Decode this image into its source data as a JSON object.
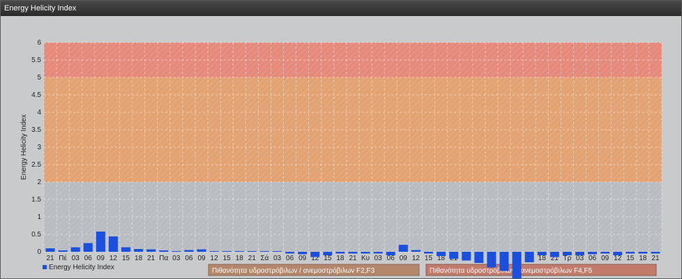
{
  "window": {
    "title": "Energy Helicity Index"
  },
  "colors": {
    "bar": "#1b4fe0",
    "band_low": "#b9bcc0",
    "band_mid": "#e3a272",
    "band_high": "#e58a7a",
    "label_box_1": "#b5876a",
    "label_box_2": "#c27a6a",
    "grid": "#f0f0f0"
  },
  "chart_data": {
    "type": "bar",
    "ylabel": "Energy Helicity Index",
    "ylim": [
      0,
      6
    ],
    "yticks": [
      "0",
      "0.5",
      "1",
      "1.5",
      "2",
      "2.5",
      "3",
      "3.5",
      "4",
      "4.5",
      "5",
      "5.5",
      "6"
    ],
    "grid": true,
    "legend_position": "bottom-left",
    "categories": [
      "21",
      "Πέ",
      "03",
      "06",
      "09",
      "12",
      "15",
      "18",
      "21",
      "Πα",
      "03",
      "06",
      "09",
      "12",
      "15",
      "18",
      "21",
      "Σά",
      "03",
      "06",
      "09",
      "12",
      "15",
      "18",
      "21",
      "Κυ",
      "03",
      "06",
      "09",
      "12",
      "15",
      "18",
      "21",
      "Δε",
      "03",
      "06",
      "09",
      "12",
      "15",
      "18",
      "21",
      "Τρ",
      "03",
      "06",
      "09",
      "12",
      "15",
      "18",
      "21"
    ],
    "series": [
      {
        "name": "Energy Helicity Index",
        "values": [
          0.1,
          0.04,
          0.13,
          0.25,
          0.58,
          0.44,
          0.13,
          0.08,
          0.07,
          0.04,
          0.02,
          0.05,
          0.07,
          0.02,
          0.02,
          0.02,
          0.02,
          0.02,
          0.02,
          -0.05,
          -0.07,
          -0.15,
          -0.1,
          -0.05,
          -0.05,
          -0.05,
          -0.05,
          -0.1,
          0.2,
          0.05,
          -0.05,
          -0.12,
          -0.2,
          -0.25,
          -0.32,
          -0.45,
          -0.55,
          -0.8,
          -0.3,
          -0.1,
          -0.15,
          -0.1,
          -0.1,
          -0.07,
          -0.05,
          -0.1,
          -0.05,
          -0.05,
          -0.05
        ]
      }
    ],
    "bands": [
      {
        "from": 0,
        "to": 2,
        "label": ""
      },
      {
        "from": 2,
        "to": 5,
        "label": ""
      },
      {
        "from": 5,
        "to": 6,
        "label": ""
      }
    ],
    "annotations": [
      "Πιθανότητα υδροστρόβιλων / ανεμοστρόβιλων F2,F3",
      "Πιθανότητα υδροστρόβιλων / ανεμοστρόβιλων F4,F5"
    ]
  }
}
